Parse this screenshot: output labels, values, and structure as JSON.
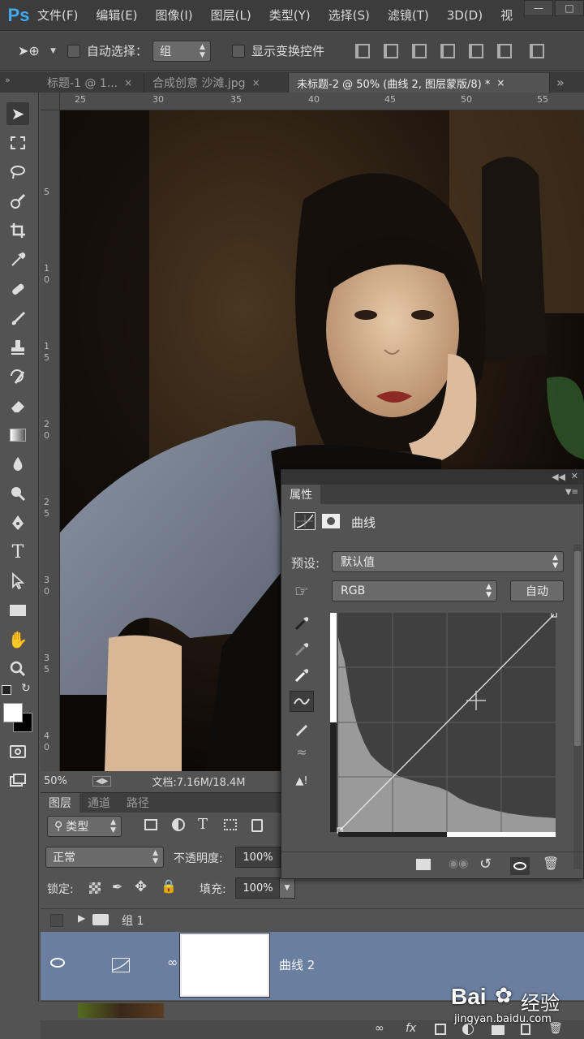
{
  "app": {
    "logo": "Ps"
  },
  "menu": [
    "文件(F)",
    "编辑(E)",
    "图像(I)",
    "图层(L)",
    "类型(Y)",
    "选择(S)",
    "滤镜(T)",
    "3D(D)",
    "视"
  ],
  "options": {
    "auto_select_label": "自动选择：",
    "auto_select_value": "组",
    "show_transform_label": "显示变换控件"
  },
  "tabs": [
    {
      "label": "标题-1 @ 1...",
      "active": false
    },
    {
      "label": "合成创意 沙滩.jpg",
      "active": false
    },
    {
      "label": "未标题-2 @ 50% (曲线 2, 图层蒙版/8) *",
      "active": true
    }
  ],
  "tab_close_glyph": "×",
  "ruler_top": [
    "25",
    "30",
    "35",
    "40",
    "45",
    "50",
    "55"
  ],
  "ruler_left": [
    "5",
    "1",
    "0",
    "1",
    "5",
    "2",
    "0",
    "2",
    "5",
    "3",
    "0",
    "3",
    "5",
    "4",
    "0"
  ],
  "status": {
    "zoom": "50%",
    "doc": "文档:7.16M/18.4M"
  },
  "layers_panel": {
    "tabs": [
      "图层",
      "通道",
      "路径"
    ],
    "filter_kind": "类型",
    "blend_mode": "正常",
    "opacity_label": "不透明度:",
    "opacity_value": "100%",
    "lock_label": "锁定:",
    "fill_label": "填充:",
    "fill_value": "100%",
    "layers": [
      {
        "name": "组 1",
        "type": "group"
      },
      {
        "name": "曲线 2",
        "type": "adjustment",
        "selected": true
      }
    ]
  },
  "properties": {
    "title": "属性",
    "adjustment_name": "曲线",
    "preset_label": "预设:",
    "preset_value": "默认值",
    "channel_value": "RGB",
    "auto_button": "自动"
  },
  "watermark": {
    "brand": "Bai",
    "brand2": "经验",
    "url": "jingyan.baidu.com"
  },
  "colors": {
    "ps_blue": "#3fa9f5",
    "layer_selected": "#6a7fa0",
    "histogram": "#9a9a9a",
    "panel_bg": "#535353"
  }
}
